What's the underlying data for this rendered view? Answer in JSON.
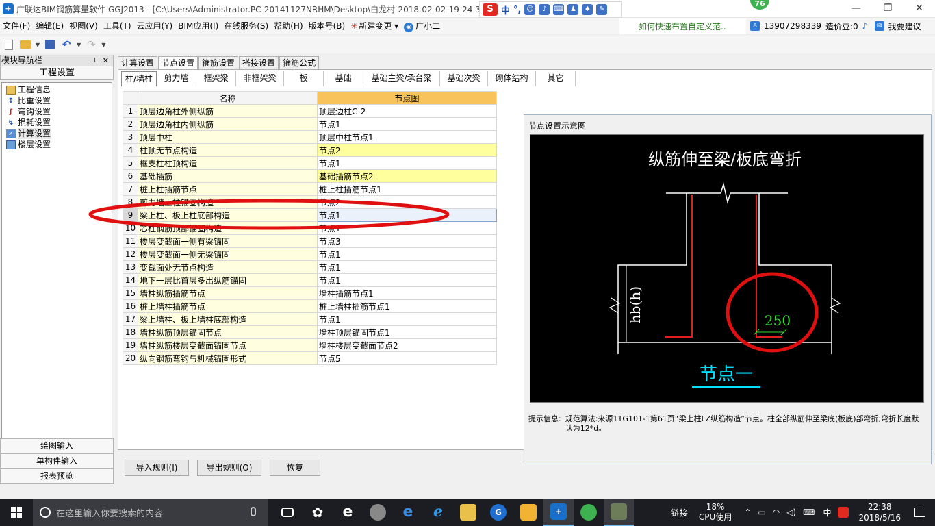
{
  "window": {
    "title": "广联达BIM钢筋算量软件 GGJ2013 - [C:\\Users\\Administrator.PC-20141127NRHM\\Desktop\\白龙村-2018-02-02-19-24-35",
    "score_badge": "76"
  },
  "ime": {
    "logo": "S",
    "mode": "中",
    "punct": "°,"
  },
  "menus": [
    "文件(F)",
    "编辑(E)",
    "视图(V)",
    "工具(T)",
    "云应用(Y)",
    "BIM应用(I)",
    "在线服务(S)",
    "帮助(H)",
    "版本号(B)",
    "新建变更",
    "广小二"
  ],
  "menu_extras": {
    "tip_link": "如何快速布置自定义范..",
    "phone": "13907298339",
    "cost_beans": "造价豆:0",
    "suggest": "我要建议"
  },
  "nav": {
    "header": "模块导航栏",
    "section_title": "工程设置",
    "items": [
      {
        "label": "工程信息",
        "icon": "info-icon"
      },
      {
        "label": "比重设置",
        "icon": "weight-icon"
      },
      {
        "label": "弯钩设置",
        "icon": "hook-icon"
      },
      {
        "label": "损耗设置",
        "icon": "loss-icon"
      },
      {
        "label": "计算设置",
        "icon": "calc-icon"
      },
      {
        "label": "楼层设置",
        "icon": "floor-icon"
      }
    ],
    "bottom": [
      "绘图输入",
      "单构件输入",
      "报表预览"
    ]
  },
  "main_tabs": [
    "计算设置",
    "节点设置",
    "箍筋设置",
    "搭接设置",
    "箍筋公式"
  ],
  "sub_tabs": [
    "柱/墙柱",
    "剪力墙",
    "框架梁",
    "非框架梁",
    "板",
    "基础",
    "基础主梁/承台梁",
    "基础次梁",
    "砌体结构",
    "其它"
  ],
  "grid": {
    "headers": {
      "name": "名称",
      "node": "节点图"
    },
    "rows": [
      {
        "idx": "1",
        "name": "顶层边角柱外侧纵筋",
        "node": "顶层边柱C-2"
      },
      {
        "idx": "2",
        "name": "顶层边角柱内侧纵筋",
        "node": "节点1"
      },
      {
        "idx": "3",
        "name": "顶层中柱",
        "node": "顶层中柱节点1"
      },
      {
        "idx": "4",
        "name": "柱顶无节点构造",
        "node": "节点2"
      },
      {
        "idx": "5",
        "name": "框支柱柱顶构造",
        "node": "节点1"
      },
      {
        "idx": "6",
        "name": "基础插筋",
        "node": "基础插筋节点2"
      },
      {
        "idx": "7",
        "name": "桩上柱插筋节点",
        "node": "桩上柱插筋节点1"
      },
      {
        "idx": "8",
        "name": "剪力墙上柱锚固构造",
        "node": "节点2"
      },
      {
        "idx": "9",
        "name": "梁上柱、板上柱底部构造",
        "node": "节点1"
      },
      {
        "idx": "10",
        "name": "芯柱钢筋顶部锚固构造",
        "node": "节点1"
      },
      {
        "idx": "11",
        "name": "楼层变截面一侧有梁锚固",
        "node": "节点3"
      },
      {
        "idx": "12",
        "name": "楼层变截面一侧无梁锚固",
        "node": "节点1"
      },
      {
        "idx": "13",
        "name": "变截面处无节点构造",
        "node": "节点1"
      },
      {
        "idx": "14",
        "name": "地下一层比首层多出纵筋锚固",
        "node": "节点1"
      },
      {
        "idx": "15",
        "name": "墙柱纵筋插筋节点",
        "node": "墙柱插筋节点1"
      },
      {
        "idx": "16",
        "name": "桩上墙柱插筋节点",
        "node": "桩上墙柱插筋节点1"
      },
      {
        "idx": "17",
        "name": "梁上墙柱、板上墙柱底部构造",
        "node": "节点1"
      },
      {
        "idx": "18",
        "name": "墙柱纵筋顶层锚固节点",
        "node": "墙柱顶层锚固节点1"
      },
      {
        "idx": "19",
        "name": "墙柱纵筋楼层变截面锚固节点",
        "node": "墙柱楼层变截面节点2"
      },
      {
        "idx": "20",
        "name": "纵向钢筋弯钩与机械锚固形式",
        "node": "节点5"
      }
    ]
  },
  "preview": {
    "title": "节点设置示意图",
    "diagram_title": "纵筋伸至梁/板底弯折",
    "dim_label": "hb(h)",
    "bend_value": "250",
    "node_caption": "节点一",
    "hint_label": "提示信息:",
    "hint_text": "规范算法:来源11G101-1第61页“梁上柱LZ纵筋构造”节点。柱全部纵筋伸至梁底(板底)部弯折;弯折长度默认为12*d。"
  },
  "buttons": {
    "import": "导入规则(I)",
    "export": "导出规则(O)",
    "restore": "恢复"
  },
  "taskbar": {
    "search_placeholder": "在这里输入你要搜索的内容",
    "link": "链接",
    "cpu_percent": "18%",
    "cpu_label": "CPU使用",
    "ime": "中",
    "time": "22:38",
    "date": "2018/5/16"
  },
  "colors": {
    "accent_red": "#e01010",
    "diagram_bg": "#000000",
    "rebar": "#e02020",
    "dim_green": "#33dd33",
    "caption_cyan": "#00e0ff",
    "highlight_yellow": "#ffff9e"
  }
}
